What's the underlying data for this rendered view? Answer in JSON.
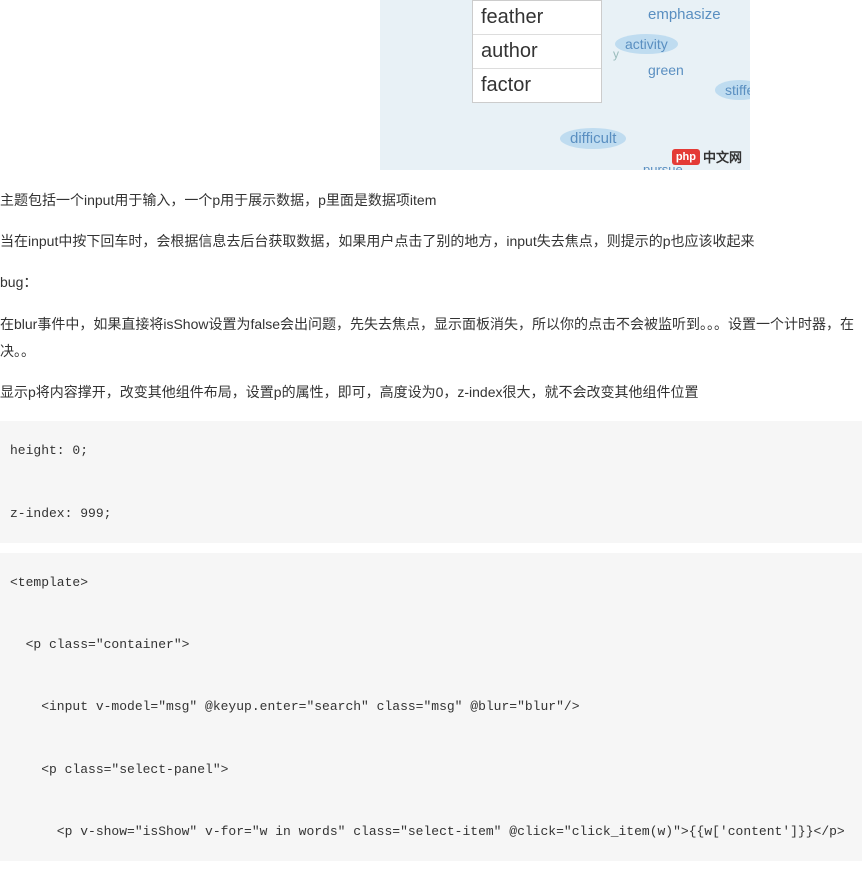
{
  "wordCloud": {
    "autocompleteItems": [
      "feather",
      "author",
      "factor"
    ],
    "cloudWords": [
      {
        "text": "emphasize",
        "style": "left:260px;top:4px;font-size:15px;"
      },
      {
        "text": "activity",
        "style": "left:235px;top:34px;font-size:14px;",
        "oval": true
      },
      {
        "text": "green",
        "style": "left:260px;top:60px;font-size:14px;"
      },
      {
        "text": "stiffe",
        "style": "left:335px;top:80px;font-size:14px;",
        "oval": true
      },
      {
        "text": "difficult",
        "style": "left:180px;top:128px;font-size:15px;",
        "oval": true
      },
      {
        "text": "pursue",
        "style": "left:255px;top:160px;font-size:13px;"
      },
      {
        "text": "y",
        "style": "left:225px;top:45px;font-size:12px;color:#9bb;"
      }
    ],
    "logo": {
      "icon": "php",
      "text": "中文网"
    }
  },
  "paragraphs": {
    "p1": "主题包括一个input用于输入，一个p用于展示数据，p里面是数据项item",
    "p2": "当在input中按下回车时，会根据信息去后台获取数据，如果用户点击了别的地方，input失去焦点，则提示的p也应该收起来",
    "p3": "bug：",
    "p4": "在blur事件中，如果直接将isShow设置为false会出问题，先失去焦点，显示面板消失，所以你的点击不会被监听到。。。设置一个计时器，在",
    "p4b": "决。。",
    "p5": "显示p将内容撑开，改变其他组件布局，设置p的属性，即可，高度设为0，z-index很大，就不会改变其他组件位置"
  },
  "codeBlock1": {
    "line1": "height: 0;",
    "line2": "z-index: 999;"
  },
  "codeBlock2": {
    "line1": "<template>",
    "line2": "  <p class=\"container\">",
    "line3": "    <input v-model=\"msg\" @keyup.enter=\"search\" class=\"msg\" @blur=\"blur\"/>",
    "line4": "    <p class=\"select-panel\">",
    "line5": "      <p v-show=\"isShow\" v-for=\"w in words\" class=\"select-item\" @click=\"click_item(w)\">{{w['content']}}</p>"
  }
}
